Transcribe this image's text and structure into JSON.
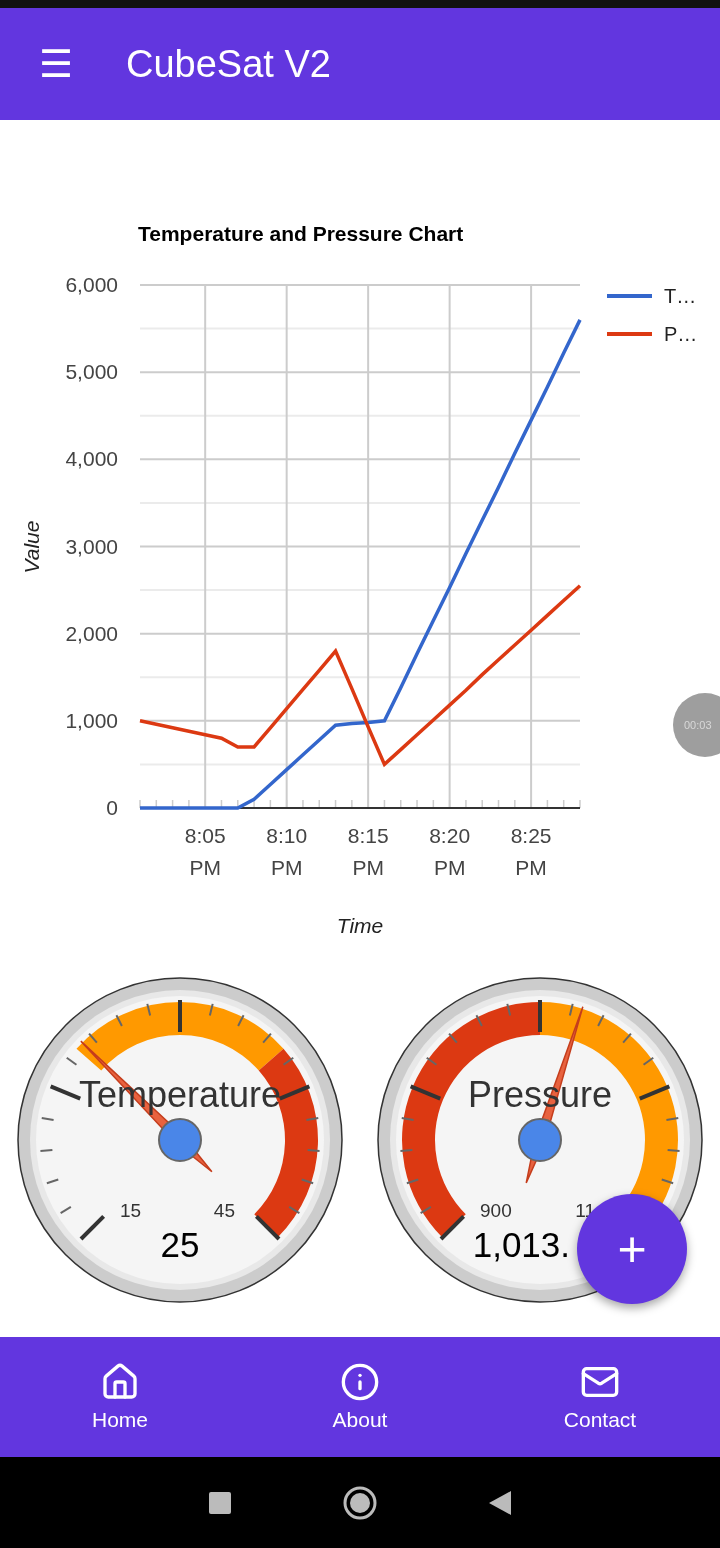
{
  "app_bar": {
    "menu_icon": "☰",
    "title": "CubeSat V2"
  },
  "chart": {
    "chart_data": {
      "type": "line",
      "title": "Temperature and Pressure Chart",
      "xlabel": "Time",
      "ylabel": "Value",
      "categories": [
        null,
        null,
        null,
        null,
        "8:05 PM",
        null,
        null,
        null,
        null,
        "8:10 PM",
        null,
        null,
        null,
        null,
        "8:15 PM",
        null,
        null,
        null,
        null,
        "8:20 PM",
        null,
        null,
        null,
        null,
        "8:25 PM",
        null,
        null,
        null
      ],
      "series": [
        {
          "name": "T…",
          "color": "#3366cc",
          "values": [
            0,
            0,
            0,
            0,
            0,
            0,
            0,
            100,
            270,
            440,
            610,
            780,
            950,
            970,
            980,
            1000,
            1380,
            1770,
            2150,
            2530,
            2920,
            3300,
            3680,
            4070,
            4450,
            4830,
            5220,
            5600
          ]
        },
        {
          "name": "P…",
          "color": "#dc3912",
          "values": [
            1000,
            960,
            920,
            880,
            840,
            800,
            700,
            700,
            920,
            1140,
            1360,
            1580,
            1800,
            1370,
            930,
            500,
            670,
            840,
            1010,
            1180,
            1350,
            1530,
            1700,
            1870,
            2040,
            2210,
            2380,
            2550
          ]
        }
      ],
      "ylim": [
        0,
        6000
      ],
      "grid": true,
      "legend": "right",
      "yticks": [
        {
          "value": 0,
          "label": "0"
        },
        {
          "value": 1000,
          "label": "1,000"
        },
        {
          "value": 2000,
          "label": "2,000"
        },
        {
          "value": 3000,
          "label": "3,000"
        },
        {
          "value": 4000,
          "label": "4,000"
        },
        {
          "value": 5000,
          "label": "5,000"
        },
        {
          "value": 6000,
          "label": "6,000"
        }
      ]
    }
  },
  "recording_badge": {
    "time": "00:03"
  },
  "gauges": [
    {
      "kind": "temperature",
      "title": "Temperature",
      "min_label": "15",
      "max_label": "45",
      "value": "25"
    },
    {
      "kind": "pressure",
      "title": "Pressure",
      "min_label": "900",
      "max_label": "11",
      "value": "1,013."
    }
  ],
  "fab": {
    "label": "+"
  },
  "bottom_nav": [
    {
      "kind": "home",
      "label": "Home"
    },
    {
      "kind": "about",
      "label": "About"
    },
    {
      "kind": "contact",
      "label": "Contact"
    }
  ]
}
